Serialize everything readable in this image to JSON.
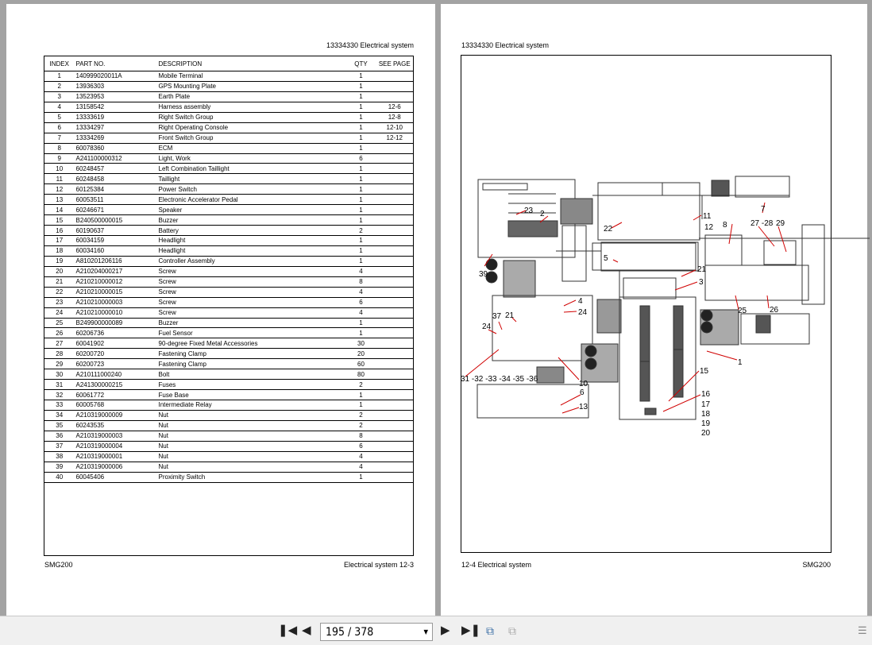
{
  "left_page": {
    "header": "13334330   Electrical system",
    "footer_left": "SMG200",
    "footer_right": "Electrical system     12-3",
    "columns": [
      "INDEX",
      "PART NO.",
      "DESCRIPTION",
      "QTY",
      "SEE PAGE"
    ],
    "rows": [
      [
        "1",
        "140999020011A",
        "Mobile Terminal",
        "1",
        ""
      ],
      [
        "2",
        "13936303",
        "GPS Mounting Plate",
        "1",
        ""
      ],
      [
        "3",
        "13523953",
        "Earth Plate",
        "1",
        ""
      ],
      [
        "4",
        "13158542",
        "Harness assembly",
        "1",
        "12-6"
      ],
      [
        "5",
        "13333619",
        "Right Switch Group",
        "1",
        "12-8"
      ],
      [
        "6",
        "13334297",
        "Right Operating Console",
        "1",
        "12-10"
      ],
      [
        "7",
        "13334269",
        "Front Switch Group",
        "1",
        "12-12"
      ],
      [
        "8",
        "60078360",
        "ECM",
        "1",
        ""
      ],
      [
        "9",
        "A241100000312",
        "Light, Work",
        "6",
        ""
      ],
      [
        "10",
        "60248457",
        "Left Combination Taillight",
        "1",
        ""
      ],
      [
        "11",
        "60248458",
        "Taillight",
        "1",
        ""
      ],
      [
        "12",
        "60125384",
        "Power Switch",
        "1",
        ""
      ],
      [
        "13",
        "60053511",
        "Electronic Accelerator Pedal",
        "1",
        ""
      ],
      [
        "14",
        "60246671",
        "Speaker",
        "1",
        ""
      ],
      [
        "15",
        "B240500000015",
        "Buzzer",
        "1",
        ""
      ],
      [
        "16",
        "60190637",
        "Battery",
        "2",
        ""
      ],
      [
        "17",
        "60034159",
        "Headlight",
        "1",
        ""
      ],
      [
        "18",
        "60034160",
        "Headlight",
        "1",
        ""
      ],
      [
        "19",
        "A810201206116",
        "Controller Assembly",
        "1",
        ""
      ],
      [
        "20",
        "A210204000217",
        "Screw",
        "4",
        ""
      ],
      [
        "21",
        "A210210000012",
        "Screw",
        "8",
        ""
      ],
      [
        "22",
        "A210210000015",
        "Screw",
        "4",
        ""
      ],
      [
        "23",
        "A210210000003",
        "Screw",
        "6",
        ""
      ],
      [
        "24",
        "A210210000010",
        "Screw",
        "4",
        ""
      ],
      [
        "25",
        "B249900000089",
        "Buzzer",
        "1",
        ""
      ],
      [
        "26",
        "60206736",
        "Fuel Sensor",
        "1",
        ""
      ],
      [
        "27",
        "60041902",
        "90-degree Fixed Metal Accessories",
        "30",
        ""
      ],
      [
        "28",
        "60200720",
        "Fastening Clamp",
        "20",
        ""
      ],
      [
        "29",
        "60200723",
        "Fastening Clamp",
        "60",
        ""
      ],
      [
        "30",
        "A210111000240",
        "Bolt",
        "80",
        ""
      ],
      [
        "31",
        "A241300000215",
        "Fuses",
        "2",
        ""
      ],
      [
        "32",
        "60061772",
        "Fuse Base",
        "1",
        ""
      ],
      [
        "33",
        "60005768",
        "Intermediate Relay",
        "1",
        ""
      ],
      [
        "34",
        "A210319000009",
        "Nut",
        "2",
        ""
      ],
      [
        "35",
        "60243535",
        "Nut",
        "2",
        ""
      ],
      [
        "36",
        "A210319000003",
        "Nut",
        "8",
        ""
      ],
      [
        "37",
        "A210319000004",
        "Nut",
        "6",
        ""
      ],
      [
        "38",
        "A210319000001",
        "Nut",
        "4",
        ""
      ],
      [
        "39",
        "A210319000006",
        "Nut",
        "4",
        ""
      ],
      [
        "40",
        "60045406",
        "Proximity Switch",
        "1",
        ""
      ]
    ]
  },
  "right_page": {
    "header": "13334330   Electrical system",
    "footer_left": "12-4     Electrical system",
    "footer_right": "SMG200",
    "callouts": [
      "23",
      "2",
      "39",
      "22",
      "11",
      "12",
      "8",
      "7",
      "27 -28",
      "29",
      "5",
      "21",
      "3",
      "4",
      "24",
      "37",
      "21",
      "24",
      "25",
      "26",
      "1",
      "15",
      "10",
      "31 -32 -33 -34 -35 -36",
      "6",
      "13",
      "16",
      "17",
      "18",
      "19",
      "20"
    ]
  },
  "toolbar": {
    "page_display": "195 / 378",
    "first_icon": "first-page-icon",
    "prev_icon": "prev-page-icon",
    "next_icon": "next-page-icon",
    "last_icon": "last-page-icon"
  },
  "colors": {
    "leader": "#d00000",
    "viewer_bg": "#a3a3a3"
  }
}
